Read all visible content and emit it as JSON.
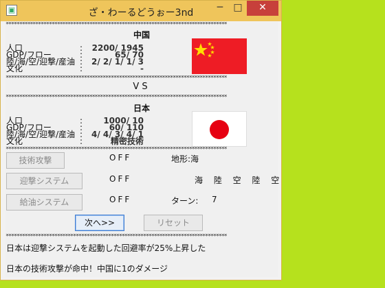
{
  "window": {
    "title": "ざ・わーるどうぉー3nd",
    "min": "─",
    "max": "□",
    "close": "✕",
    "icon": "▣"
  },
  "stars": "**********************************************************************************",
  "country1": {
    "name": "中国",
    "labels": [
      "人口",
      "GDP/フロー",
      "陸/海/空/迎撃/産油",
      "文化"
    ],
    "colons": [
      ":",
      ":",
      ":",
      ":"
    ],
    "values": [
      "2200/ 1945",
      "65/ 70",
      "2/ 2/ 1/ 1/ 3",
      "-"
    ]
  },
  "vs": "VS",
  "country2": {
    "name": "日本",
    "labels": [
      "人口",
      "GDP/フロー",
      "陸/海/空/迎撃/産油",
      "文化"
    ],
    "colons": [
      ":",
      ":",
      ":",
      ":"
    ],
    "values": [
      "1000/ 10",
      "60/ 110",
      "4/ 4/ 3/ 4/ 1",
      "精密技術"
    ]
  },
  "controls": {
    "tech_attack": "技術攻撃",
    "intercept_system": "迎撃システム",
    "refuel_system": "給油システム",
    "tech_status": "OFF",
    "intercept_status": "OFF",
    "refuel_status": "OFF",
    "terrain_label": "地形:海",
    "terrain_units": "海 陸 空 陸 空",
    "turn_label": "ターン:",
    "turn_value": "7",
    "next_button": "次へ>>",
    "reset_button": "リセット"
  },
  "messages": [
    "日本は迎撃システムを起動した回避率が25%上昇した",
    "日本の技術攻撃が命中！中国に1のダメージ"
  ]
}
